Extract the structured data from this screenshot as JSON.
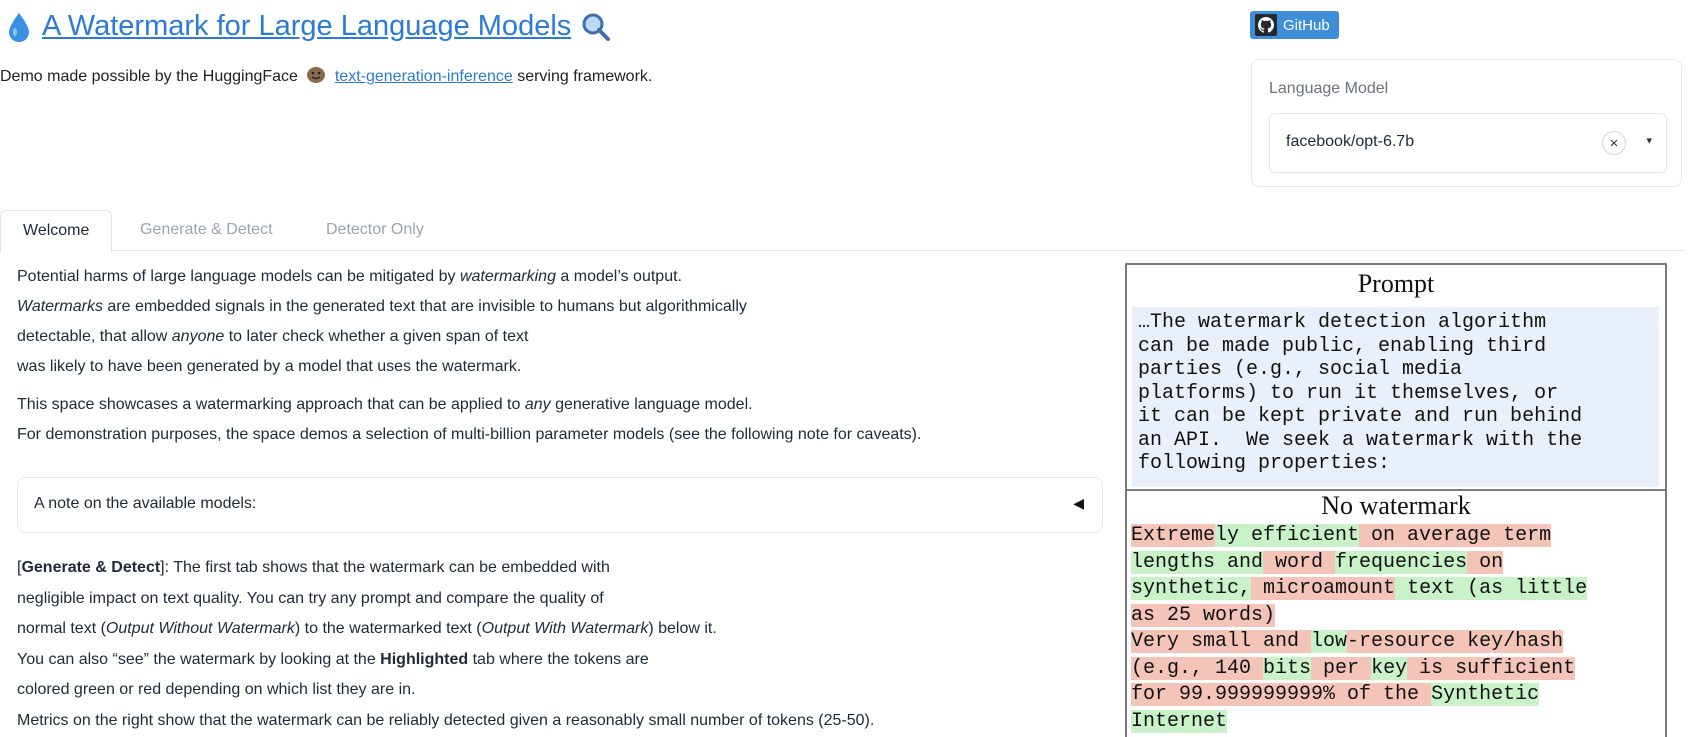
{
  "header": {
    "title": "A Watermark for Large Language Models",
    "subtitle_prefix": "Demo made possible by the HuggingFace",
    "subtitle_link": "text-generation-inference",
    "subtitle_suffix": "serving framework."
  },
  "github_button": "GitHub",
  "model_selector": {
    "label": "Language Model",
    "value": "facebook/opt-6.7b",
    "clear_glyph": "×",
    "caret_glyph": "▾"
  },
  "tabs": [
    {
      "label": "Welcome",
      "active": true
    },
    {
      "label": "Generate & Detect",
      "active": false
    },
    {
      "label": "Detector Only",
      "active": false
    }
  ],
  "intro": {
    "p1_a": "Potential harms of large language models can be mitigated by ",
    "p1_em": "watermarking",
    "p1_b": " a model’s output.",
    "p2_em": "Watermarks",
    "p2_a": " are embedded signals in the generated text that are invisible to humans but algorithmically",
    "p3_a": "detectable, that allow ",
    "p3_em": "anyone",
    "p3_b": " to later check whether a given span of text",
    "p4": "was likely to have been generated by a model that uses the watermark.",
    "p5_a": "This space showcases a watermarking approach that can be applied to ",
    "p5_em": "any",
    "p5_b": " generative language model.",
    "p6": "For demonstration purposes, the space demos a selection of multi-billion parameter models (see the following note for caveats)."
  },
  "note_accordion": {
    "label": "A note on the available models:",
    "arrow": "◀"
  },
  "generate_section": {
    "l1_open": "[",
    "l1_bold": "Generate & Detect",
    "l1_close": "]: The first tab shows that the watermark can be embedded with",
    "l2": "negligible impact on text quality. You can try any prompt and compare the quality of",
    "l3_a": "normal text (",
    "l3_em1": "Output Without Watermark",
    "l3_b": ") to the watermarked text (",
    "l3_em2": "Output With Watermark",
    "l3_c": ") below it.",
    "l4_a": "You can also “see” the watermark by looking at the ",
    "l4_bold": "Highlighted",
    "l4_b": " tab where the tokens are",
    "l5": "colored green or red depending on which list they are in.",
    "l6": "Metrics on the right show that the watermark can be reliably detected given a reasonably small number of tokens (25-50)."
  },
  "figure": {
    "prompt_heading": "Prompt",
    "prompt_text": "…The watermark detection algorithm\ncan be made public, enabling third\nparties (e.g., social media\nplatforms) to run it themselves, or\nit can be kept private and run behind\nan API.  We seek a watermark with the\nfollowing properties:",
    "nowm_heading": "No watermark",
    "colors": {
      "green": "#c9f2c9",
      "red": "#f5c4b8",
      "prompt_bg": "#eaf0fb"
    },
    "lines": [
      [
        [
          "r",
          "Extreme"
        ],
        [
          "g",
          "ly efficient"
        ],
        [
          "r",
          " on average term"
        ]
      ],
      [
        [
          "g",
          "lengths and"
        ],
        [
          "r",
          " word "
        ],
        [
          "g",
          "frequencies"
        ],
        [
          "r",
          " on"
        ]
      ],
      [
        [
          "g",
          "synthetic,"
        ],
        [
          "r",
          " microamount"
        ],
        [
          "g",
          " text (as little"
        ]
      ],
      [
        [
          "r",
          "as 25 words)"
        ]
      ],
      [
        [
          "r",
          "Very small and "
        ],
        [
          "g",
          "low"
        ],
        [
          "r",
          "-resource key/hash"
        ]
      ],
      [
        [
          "r",
          "(e.g., 140 "
        ],
        [
          "g",
          "bits"
        ],
        [
          "r",
          " per "
        ],
        [
          "g",
          "key"
        ],
        [
          "r",
          " is sufficient"
        ]
      ],
      [
        [
          "r",
          "for 99.999999999% of the "
        ],
        [
          "g",
          "Synthetic"
        ]
      ],
      [
        [
          "g",
          "Internet"
        ]
      ]
    ]
  }
}
